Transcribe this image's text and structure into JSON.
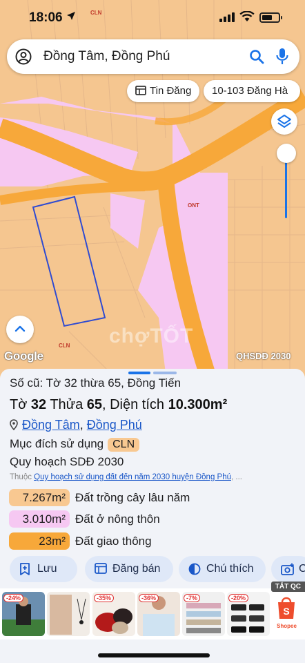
{
  "status_bar": {
    "time": "18:06",
    "tiny_label": "CLN"
  },
  "search": {
    "query": "Đồng Tâm, Đồng Phú"
  },
  "chips": {
    "listing": "Tin Đăng",
    "address": "10-103 Đăng Hà"
  },
  "map": {
    "label_ont": "ONT",
    "label_cln": "CLN",
    "google": "Google",
    "layer_name": "QHSDĐ 2030",
    "watermark": "chợTỐT"
  },
  "sheet": {
    "old_plot": "Số cũ: Tờ 32 thừa 65, Đồng Tiến",
    "sheet_prefix": "Tờ ",
    "sheet_no": "32",
    "parcel_prefix": " Thửa ",
    "parcel_no": "65",
    "area_prefix": ", Diện tích ",
    "area_value": "10.300m²",
    "commune": "Đồng Tâm",
    "separator": ", ",
    "district": "Đồng Phú",
    "purpose_label": "Mục đích sử dụng",
    "purpose_code": "CLN",
    "plan_label": "Quy hoạch SDĐ 2030",
    "belongs_prefix": "Thuộc ",
    "belongs_link": "Quy hoạch sử dụng đất đến năm 2030 huyện Đồng Phú",
    "belongs_suffix": ", ..."
  },
  "land_uses": [
    {
      "area": "7.267m²",
      "label": "Đất trồng cây lâu năm",
      "color": "#f8c891"
    },
    {
      "area": "3.010m²",
      "label": "Đất ở nông thôn",
      "color": "#f6c8f2"
    },
    {
      "area": "23m²",
      "label": "Đất giao thông",
      "color": "#f7a83a"
    }
  ],
  "actions": {
    "save": "Lưu",
    "sell": "Đăng bán",
    "legend": "Chú thích",
    "more": "C"
  },
  "ads": {
    "tag": "TẮT QC",
    "badges": [
      "-24%",
      "-35%",
      "-36%",
      "-7%",
      "-20%"
    ],
    "shopee": "Shopee"
  },
  "colors": {
    "cln": "#f5c690",
    "ont": "#f6c8f2",
    "road": "#f7a83a",
    "accent": "#1a73e8"
  }
}
